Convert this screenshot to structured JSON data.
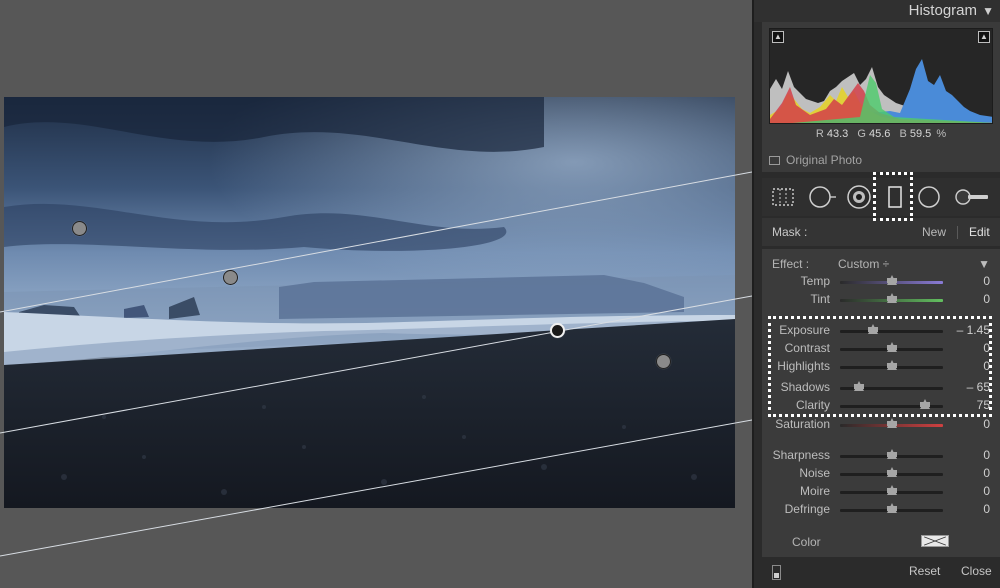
{
  "histogram": {
    "title": "Histogram",
    "collapse_icon": "triangle-down-icon",
    "readout": {
      "r_label": "R",
      "r_value": "43.3",
      "g_label": "G",
      "g_value": "45.6",
      "b_label": "B",
      "b_value": "59.5",
      "unit": "%"
    },
    "original_photo_label": "Original Photo"
  },
  "tools": [
    {
      "name": "crop-overlay-tool-icon"
    },
    {
      "name": "spot-removal-tool-icon"
    },
    {
      "name": "red-eye-tool-icon"
    },
    {
      "name": "graduated-filter-tool-icon",
      "active": true
    },
    {
      "name": "radial-filter-tool-icon"
    },
    {
      "name": "adjustment-brush-tool-icon"
    }
  ],
  "mask": {
    "label": "Mask :",
    "new_label": "New",
    "edit_label": "Edit"
  },
  "effect": {
    "label": "Effect :",
    "value": "Custom ÷"
  },
  "sliders": [
    {
      "label": "Temp",
      "value": "0",
      "pos": 0.5
    },
    {
      "label": "Tint",
      "value": "0",
      "pos": 0.5
    },
    {
      "label": "Exposure",
      "value": "– 1.45",
      "pos": 0.32
    },
    {
      "label": "Contrast",
      "value": "0",
      "pos": 0.5
    },
    {
      "label": "Highlights",
      "value": "0",
      "pos": 0.5
    },
    {
      "label": "Shadows",
      "value": "– 65",
      "pos": 0.18
    },
    {
      "label": "Clarity",
      "value": "75",
      "pos": 0.83
    },
    {
      "label": "Saturation",
      "value": "0",
      "pos": 0.5
    },
    {
      "label": "Sharpness",
      "value": "0",
      "pos": 0.5
    },
    {
      "label": "Noise",
      "value": "0",
      "pos": 0.5
    },
    {
      "label": "Moire",
      "value": "0",
      "pos": 0.5
    },
    {
      "label": "Defringe",
      "value": "0",
      "pos": 0.5
    }
  ],
  "color": {
    "label": "Color"
  },
  "footer": {
    "reset_label": "Reset",
    "close_label": "Close"
  },
  "colors": {
    "panel_bg": "#2b2b2b",
    "section_bg": "#3b3b3b",
    "canvas_bg": "#575757",
    "temp_track": "#8a7bd6",
    "tint_track": "#63c060",
    "saturation_track": "#d04040"
  }
}
